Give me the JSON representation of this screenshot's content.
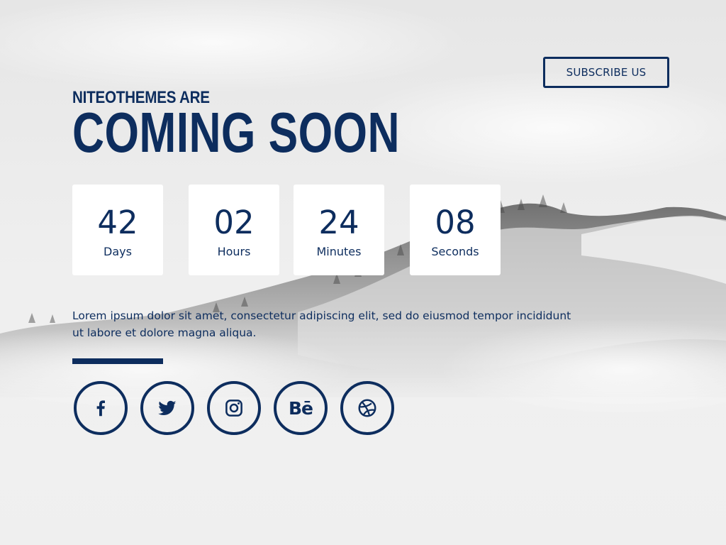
{
  "header": {
    "subscribe_label": "SUBSCRIBE US"
  },
  "hero": {
    "eyebrow": "NITEOTHEMES ARE",
    "title": "COMING SOON"
  },
  "countdown": [
    {
      "value": "42",
      "label": "Days"
    },
    {
      "value": "02",
      "label": "Hours"
    },
    {
      "value": "24",
      "label": "Minutes"
    },
    {
      "value": "08",
      "label": "Seconds"
    }
  ],
  "description": "Lorem ipsum dolor sit amet, consectetur adipiscing elit, sed do eiusmod tempor incididunt ut labore et dolore magna aliqua.",
  "social": {
    "icons": [
      "facebook-icon",
      "twitter-icon",
      "instagram-icon",
      "behance-icon",
      "dribbble-icon"
    ],
    "behance_glyph": "Bē"
  },
  "colors": {
    "accent": "#0d2d5e",
    "tile": "#ffffff",
    "background": "#eeeeee"
  }
}
